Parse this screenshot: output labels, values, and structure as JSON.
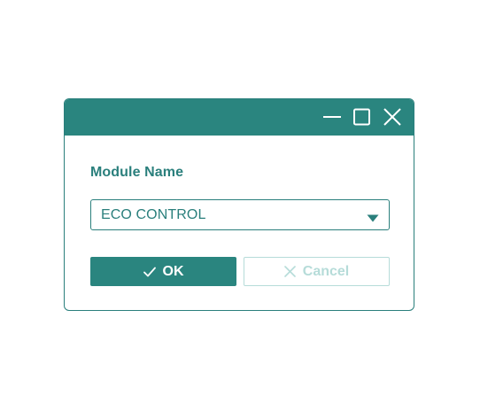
{
  "dialog": {
    "window_controls": {
      "minimize_icon": "minimize-icon",
      "maximize_icon": "maximize-icon",
      "close_icon": "close-icon"
    },
    "field_label": "Module Name",
    "select": {
      "value": "ECO CONTROL",
      "caret_icon": "caret-down-icon"
    },
    "ok_button": {
      "label": "OK",
      "icon": "check-icon"
    },
    "cancel_button": {
      "label": "Cancel",
      "icon": "x-icon"
    }
  },
  "colors": {
    "accent": "#2a857f",
    "text": "#2a7f7c",
    "disabled": "#b6dcd9",
    "background": "#ffffff"
  }
}
